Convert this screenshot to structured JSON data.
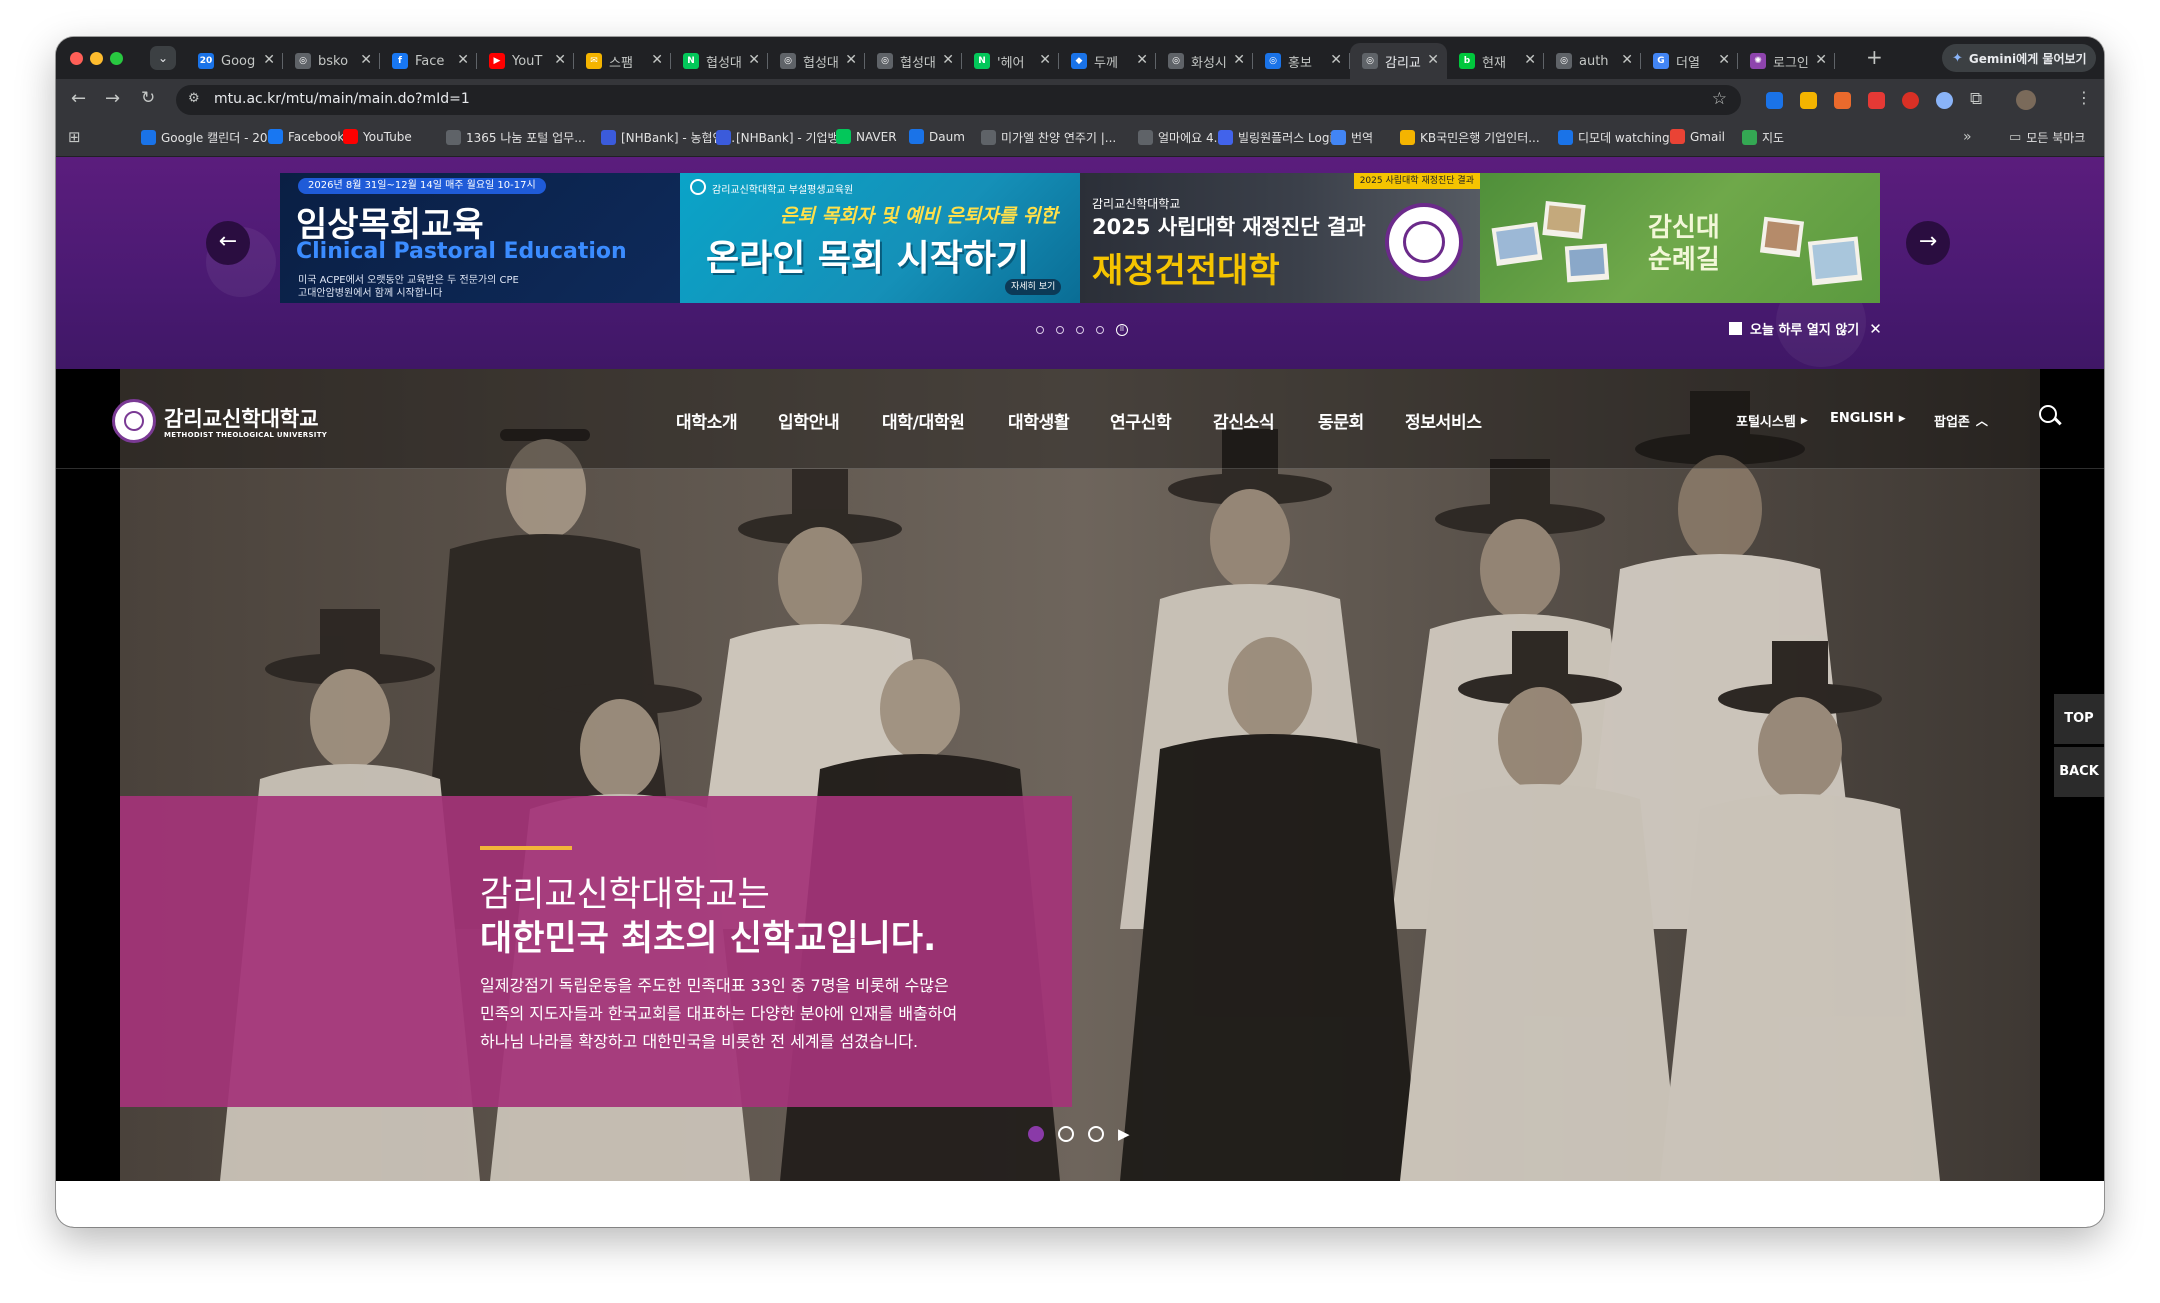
{
  "browser": {
    "tabs": [
      {
        "label": "Goog",
        "icon": "calendar-icon",
        "color": "#1a73e8"
      },
      {
        "label": "bsko",
        "icon": "globe-icon",
        "color": "#5f6368"
      },
      {
        "label": "Face",
        "icon": "facebook-icon",
        "color": "#1877f2"
      },
      {
        "label": "YouT",
        "icon": "youtube-icon",
        "color": "#ff0000"
      },
      {
        "label": "스팸",
        "icon": "mail-icon",
        "color": "#f4b400"
      },
      {
        "label": "협성대",
        "icon": "naver-icon",
        "color": "#03c75a"
      },
      {
        "label": "협성대",
        "icon": "globe-icon",
        "color": "#5f6368"
      },
      {
        "label": "협성대",
        "icon": "globe-icon",
        "color": "#5f6368"
      },
      {
        "label": "'헤어",
        "icon": "naver-icon",
        "color": "#03c75a"
      },
      {
        "label": "두께",
        "icon": "pin-icon",
        "color": "#1a73e8"
      },
      {
        "label": "화성시",
        "icon": "globe-icon",
        "color": "#5f6368"
      },
      {
        "label": "홍보",
        "icon": "globe-icon",
        "color": "#1a73e8"
      },
      {
        "label": "감리교",
        "icon": "globe-icon",
        "color": "#5f6368",
        "active": true
      },
      {
        "label": "현재",
        "icon": "blog-icon",
        "color": "#00c73c"
      },
      {
        "label": "auth",
        "icon": "globe-icon",
        "color": "#5f6368"
      },
      {
        "label": "더열",
        "icon": "google-icon",
        "color": "#4285f4"
      },
      {
        "label": "로그인",
        "icon": "star-icon",
        "color": "#8e44ad"
      }
    ],
    "gemini_label": "Gemini에게 물어보기",
    "url": "mtu.ac.kr/mtu/main/main.do?mId=1",
    "bookmarks": [
      "Google 캘린더 - 20...",
      "Facebook",
      "YouTube",
      "1365 나눔 포털 업무...",
      "[NHBank] - 농협인...",
      "[NHBank] - 기업뱅킹",
      "NAVER",
      "Daum",
      "미가엘 찬양 연주기 |...",
      "얼마에요 4.0",
      "빌링원플러스 Login",
      "번역",
      "KB국민은행 기업인터...",
      "디모데 watching",
      "Gmail",
      "지도"
    ],
    "bookmarks_more": "»",
    "all_bookmarks": "모든 북마크"
  },
  "popup": {
    "banner1": {
      "top": "2026년 8월 31일~12월 14일 매주 월요일 10-17시",
      "title": "임상목회교육",
      "subtitle": "Clinical Pastoral Education",
      "line1": "미국 ACPE에서 오랫동안 교육받은 두 전문가의 CPE",
      "line2": "고대안암병원에서 함께 시작합니다"
    },
    "banner2": {
      "top": "감리교신학대학교 부설평생교육원",
      "line1": "은퇴 목회자 및 예비 은퇴자를 위한",
      "title": "온라인 목회 시작하기",
      "more": "자세히 보기"
    },
    "banner3": {
      "badge": "2025 사립대학 재정진단 결과",
      "small": "감리교신학대학교",
      "line1": "2025 사립대학 재정진단 결과",
      "title": "재정건전대학"
    },
    "banner4": {
      "title1": "감신대",
      "title2": "순례길"
    },
    "close_today": "오늘 하루 열지 않기",
    "close_x": "✕"
  },
  "site": {
    "logo_ko": "감리교신학대학교",
    "logo_en": "METHODIST THEOLOGICAL UNIVERSITY",
    "nav": [
      "대학소개",
      "입학안내",
      "대학/대학원",
      "대학생활",
      "연구신학",
      "감신소식",
      "동문회",
      "정보서비스"
    ],
    "util": {
      "portal": "포털시스템",
      "english": "ENGLISH",
      "popup": "팝업존"
    },
    "hero": {
      "line1": "감리교신학대학교는",
      "line2": "대한민국 최초의 신학교입니다.",
      "p1": "일제강점기 독립운동을 주도한 민족대표 33인 중 7명을 비롯해 수많은",
      "p2": "민족의 지도자들과 한국교회를 대표하는 다양한 분야에 인재를 배출하여",
      "p3": "하나님 나라를 확장하고 대한민국을 비롯한 전 세계를 섬겼습니다."
    },
    "side": {
      "top": "TOP",
      "back": "BACK"
    }
  }
}
